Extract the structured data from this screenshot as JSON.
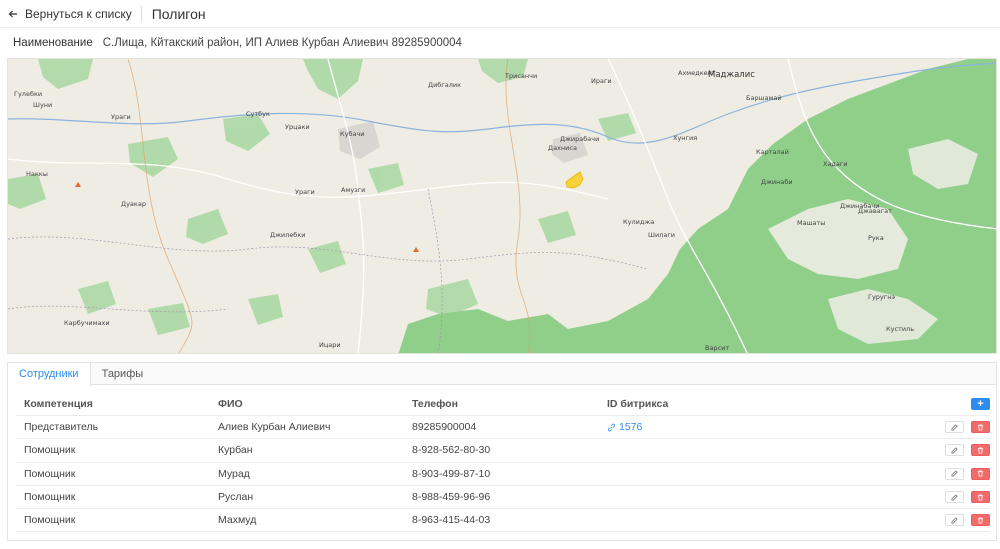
{
  "header": {
    "back_label": "Вернуться к списку",
    "title": "Полигон"
  },
  "name_row": {
    "label": "Наименование",
    "value": "С.Лища, Кйтакский район, ИП Алиев Курбан Алиевич 89285900004"
  },
  "map": {
    "places": [
      "Гулебки",
      "Шуни",
      "Ураги",
      "Сутбук",
      "Урцаки",
      "Кубачи",
      "Дибгалик",
      "Трисанчи",
      "Ираги",
      "Ахмедкент",
      "Маджалис",
      "Баршамай",
      "Наккы",
      "Джирабачи",
      "Дахниса",
      "Хунгия",
      "Карталай",
      "Хадаги",
      "Джинаби",
      "Дуакар",
      "Ураги",
      "Амузги",
      "Кулиджа",
      "Шилаги",
      "Машаты",
      "Джинабачи",
      "Джавагат",
      "Джилебки",
      "Рука",
      "Гуругнэ",
      "Карбучимахи",
      "Ицари",
      "Варсит",
      "Кустиль"
    ]
  },
  "tabs": [
    {
      "label": "Сотрудники"
    },
    {
      "label": "Тарифы"
    }
  ],
  "table": {
    "columns": [
      "Компетенция",
      "ФИО",
      "Телефон",
      "ID битрикса"
    ],
    "add_label": "+",
    "rows": [
      {
        "role": "Представитель",
        "name": "Алиев Курбан Алиевич",
        "phone": "89285900004",
        "bitrix": "1576"
      },
      {
        "role": "Помощник",
        "name": "Курбан",
        "phone": "8-928-562-80-30",
        "bitrix": ""
      },
      {
        "role": "Помощник",
        "name": "Мурад",
        "phone": "8-903-499-87-10",
        "bitrix": ""
      },
      {
        "role": "Помощник",
        "name": "Руслан",
        "phone": "8-988-459-96-96",
        "bitrix": ""
      },
      {
        "role": "Помощник",
        "name": "Махмуд",
        "phone": "8-963-415-44-03",
        "bitrix": ""
      }
    ]
  },
  "colors": {
    "accent": "#2d8cf0",
    "danger": "#f16b6b",
    "map_land": "#efece4",
    "map_forest": "#8fcf8a",
    "polygon": "#f5d23a"
  }
}
